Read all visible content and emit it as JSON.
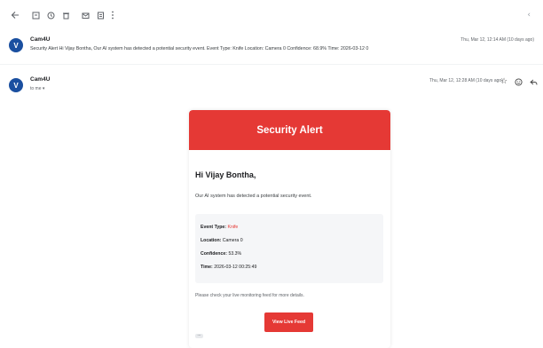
{
  "toolbar": {
    "back_icon": "arrow-left-icon",
    "archive_icon": "archive-icon",
    "report_icon": "clock-icon",
    "delete_icon": "trash-icon",
    "mark_unread_icon": "envelope-icon",
    "move_icon": "folder-icon",
    "more_icon": "more-vertical-icon",
    "collapse_icon": "chevron-left-icon"
  },
  "collapsed_message": {
    "avatar_letter": "V",
    "sender": "Cam4U",
    "snippet": "Security Alert Hi Vijay Bontha, Our AI system has detected a potential security event. Event Type: Knife Location: Camera 0 Confidence: 68.9% Time: 2026-03-12 0",
    "date": "Thu, Mar 12, 12:14 AM (10 days ago)"
  },
  "expanded_message": {
    "avatar_letter": "V",
    "sender": "Cam4U",
    "to": "to me ▾",
    "date": "Thu, Mar 12, 12:28 AM (10 days ago)",
    "star_icon": "star-icon",
    "emoji_icon": "emoji-icon",
    "reply_icon": "reply-icon"
  },
  "email": {
    "header_title": "Security Alert",
    "greeting": "Hi Vijay Bontha,",
    "intro": "Our AI system has detected a potential security event.",
    "details": {
      "event_label": "Event Type:",
      "event_value": "Knife",
      "location_label": "Location:",
      "location_value": "Camera 0",
      "confidence_label": "Confidence:",
      "confidence_value": "53.3%",
      "time_label": "Time:",
      "time_value": "2026-03-12 00:25:49"
    },
    "note": "Please check your live monitoring feed for more details.",
    "button_label": "View Live Feed",
    "ellipsis": "..."
  },
  "colors": {
    "accent_red": "#e53935",
    "avatar_blue": "#1a4fa0"
  }
}
